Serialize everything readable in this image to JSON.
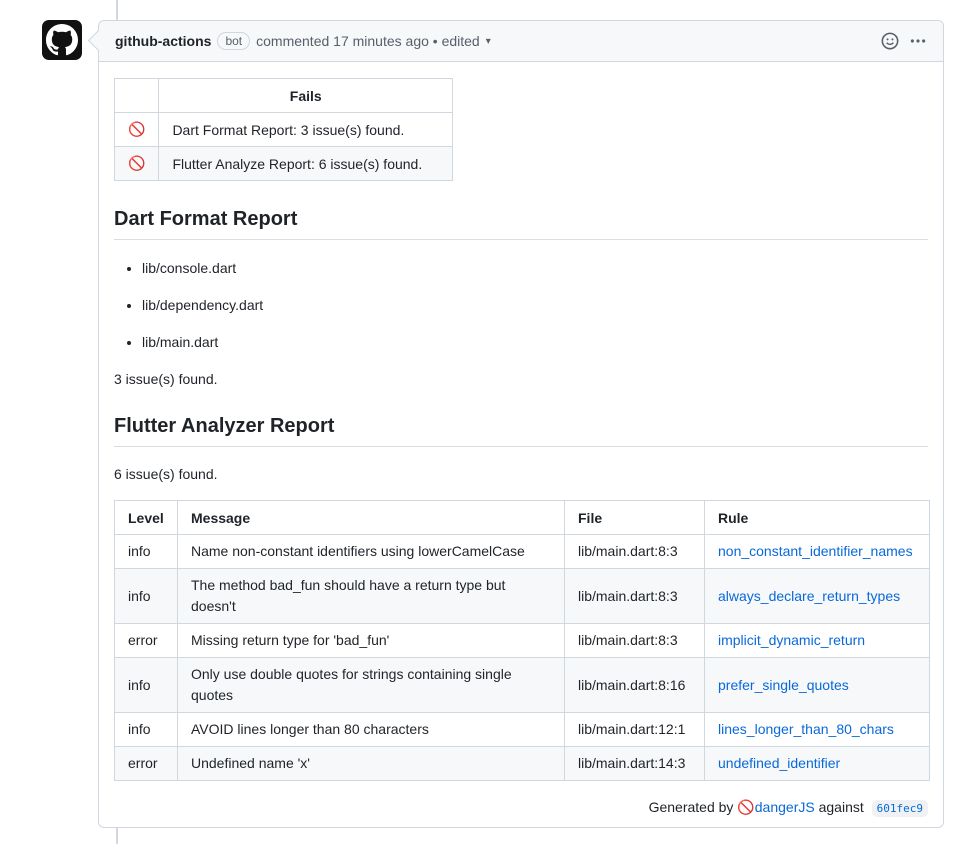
{
  "comment": {
    "author": "github-actions",
    "badge": "bot",
    "meta": "commented 17 minutes ago • edited",
    "caret": "▾"
  },
  "fails_table": {
    "header": "Fails",
    "rows": [
      {
        "icon": "🚫",
        "text": "Dart Format Report: 3 issue(s) found."
      },
      {
        "icon": "🚫",
        "text": "Flutter Analyze Report: 6 issue(s) found."
      }
    ]
  },
  "dart_format": {
    "title": "Dart Format Report",
    "files": [
      "lib/console.dart",
      "lib/dependency.dart",
      "lib/main.dart"
    ],
    "summary": "3 issue(s) found."
  },
  "flutter_analyzer": {
    "title": "Flutter Analyzer Report",
    "summary": "6 issue(s) found.",
    "columns": [
      "Level",
      "Message",
      "File",
      "Rule"
    ],
    "rows": [
      {
        "level": "info",
        "message": "Name non-constant identifiers using lowerCamelCase",
        "file": "lib/main.dart:8:3",
        "rule": "non_constant_identifier_names"
      },
      {
        "level": "info",
        "message": "The method bad_fun should have a return type but doesn't",
        "file": "lib/main.dart:8:3",
        "rule": "always_declare_return_types"
      },
      {
        "level": "error",
        "message": "Missing return type for 'bad_fun'",
        "file": "lib/main.dart:8:3",
        "rule": "implicit_dynamic_return"
      },
      {
        "level": "info",
        "message": "Only use double quotes for strings containing single quotes",
        "file": "lib/main.dart:8:16",
        "rule": "prefer_single_quotes"
      },
      {
        "level": "info",
        "message": "AVOID lines longer than 80 characters",
        "file": "lib/main.dart:12:1",
        "rule": "lines_longer_than_80_chars"
      },
      {
        "level": "error",
        "message": "Undefined name 'x'",
        "file": "lib/main.dart:14:3",
        "rule": "undefined_identifier"
      }
    ]
  },
  "footer": {
    "prefix": "Generated by",
    "icon": "🚫",
    "link": "dangerJS",
    "against": "against",
    "sha": "601fec9"
  },
  "icons": {
    "avatar": "github-octocat-icon",
    "emoji": "smiley-icon",
    "more": "kebab-horizontal-icon"
  }
}
